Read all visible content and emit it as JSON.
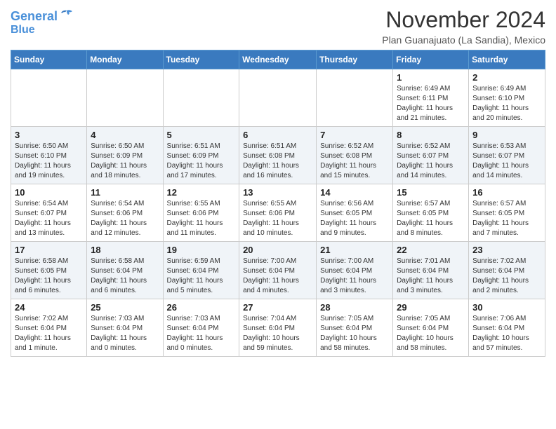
{
  "header": {
    "logo_line1": "General",
    "logo_line2": "Blue",
    "month": "November 2024",
    "location": "Plan Guanajuato (La Sandia), Mexico"
  },
  "weekdays": [
    "Sunday",
    "Monday",
    "Tuesday",
    "Wednesday",
    "Thursday",
    "Friday",
    "Saturday"
  ],
  "weeks": [
    [
      {
        "day": "",
        "info": ""
      },
      {
        "day": "",
        "info": ""
      },
      {
        "day": "",
        "info": ""
      },
      {
        "day": "",
        "info": ""
      },
      {
        "day": "",
        "info": ""
      },
      {
        "day": "1",
        "info": "Sunrise: 6:49 AM\nSunset: 6:11 PM\nDaylight: 11 hours\nand 21 minutes."
      },
      {
        "day": "2",
        "info": "Sunrise: 6:49 AM\nSunset: 6:10 PM\nDaylight: 11 hours\nand 20 minutes."
      }
    ],
    [
      {
        "day": "3",
        "info": "Sunrise: 6:50 AM\nSunset: 6:10 PM\nDaylight: 11 hours\nand 19 minutes."
      },
      {
        "day": "4",
        "info": "Sunrise: 6:50 AM\nSunset: 6:09 PM\nDaylight: 11 hours\nand 18 minutes."
      },
      {
        "day": "5",
        "info": "Sunrise: 6:51 AM\nSunset: 6:09 PM\nDaylight: 11 hours\nand 17 minutes."
      },
      {
        "day": "6",
        "info": "Sunrise: 6:51 AM\nSunset: 6:08 PM\nDaylight: 11 hours\nand 16 minutes."
      },
      {
        "day": "7",
        "info": "Sunrise: 6:52 AM\nSunset: 6:08 PM\nDaylight: 11 hours\nand 15 minutes."
      },
      {
        "day": "8",
        "info": "Sunrise: 6:52 AM\nSunset: 6:07 PM\nDaylight: 11 hours\nand 14 minutes."
      },
      {
        "day": "9",
        "info": "Sunrise: 6:53 AM\nSunset: 6:07 PM\nDaylight: 11 hours\nand 14 minutes."
      }
    ],
    [
      {
        "day": "10",
        "info": "Sunrise: 6:54 AM\nSunset: 6:07 PM\nDaylight: 11 hours\nand 13 minutes."
      },
      {
        "day": "11",
        "info": "Sunrise: 6:54 AM\nSunset: 6:06 PM\nDaylight: 11 hours\nand 12 minutes."
      },
      {
        "day": "12",
        "info": "Sunrise: 6:55 AM\nSunset: 6:06 PM\nDaylight: 11 hours\nand 11 minutes."
      },
      {
        "day": "13",
        "info": "Sunrise: 6:55 AM\nSunset: 6:06 PM\nDaylight: 11 hours\nand 10 minutes."
      },
      {
        "day": "14",
        "info": "Sunrise: 6:56 AM\nSunset: 6:05 PM\nDaylight: 11 hours\nand 9 minutes."
      },
      {
        "day": "15",
        "info": "Sunrise: 6:57 AM\nSunset: 6:05 PM\nDaylight: 11 hours\nand 8 minutes."
      },
      {
        "day": "16",
        "info": "Sunrise: 6:57 AM\nSunset: 6:05 PM\nDaylight: 11 hours\nand 7 minutes."
      }
    ],
    [
      {
        "day": "17",
        "info": "Sunrise: 6:58 AM\nSunset: 6:05 PM\nDaylight: 11 hours\nand 6 minutes."
      },
      {
        "day": "18",
        "info": "Sunrise: 6:58 AM\nSunset: 6:04 PM\nDaylight: 11 hours\nand 6 minutes."
      },
      {
        "day": "19",
        "info": "Sunrise: 6:59 AM\nSunset: 6:04 PM\nDaylight: 11 hours\nand 5 minutes."
      },
      {
        "day": "20",
        "info": "Sunrise: 7:00 AM\nSunset: 6:04 PM\nDaylight: 11 hours\nand 4 minutes."
      },
      {
        "day": "21",
        "info": "Sunrise: 7:00 AM\nSunset: 6:04 PM\nDaylight: 11 hours\nand 3 minutes."
      },
      {
        "day": "22",
        "info": "Sunrise: 7:01 AM\nSunset: 6:04 PM\nDaylight: 11 hours\nand 3 minutes."
      },
      {
        "day": "23",
        "info": "Sunrise: 7:02 AM\nSunset: 6:04 PM\nDaylight: 11 hours\nand 2 minutes."
      }
    ],
    [
      {
        "day": "24",
        "info": "Sunrise: 7:02 AM\nSunset: 6:04 PM\nDaylight: 11 hours\nand 1 minute."
      },
      {
        "day": "25",
        "info": "Sunrise: 7:03 AM\nSunset: 6:04 PM\nDaylight: 11 hours\nand 0 minutes."
      },
      {
        "day": "26",
        "info": "Sunrise: 7:03 AM\nSunset: 6:04 PM\nDaylight: 11 hours\nand 0 minutes."
      },
      {
        "day": "27",
        "info": "Sunrise: 7:04 AM\nSunset: 6:04 PM\nDaylight: 10 hours\nand 59 minutes."
      },
      {
        "day": "28",
        "info": "Sunrise: 7:05 AM\nSunset: 6:04 PM\nDaylight: 10 hours\nand 58 minutes."
      },
      {
        "day": "29",
        "info": "Sunrise: 7:05 AM\nSunset: 6:04 PM\nDaylight: 10 hours\nand 58 minutes."
      },
      {
        "day": "30",
        "info": "Sunrise: 7:06 AM\nSunset: 6:04 PM\nDaylight: 10 hours\nand 57 minutes."
      }
    ]
  ]
}
